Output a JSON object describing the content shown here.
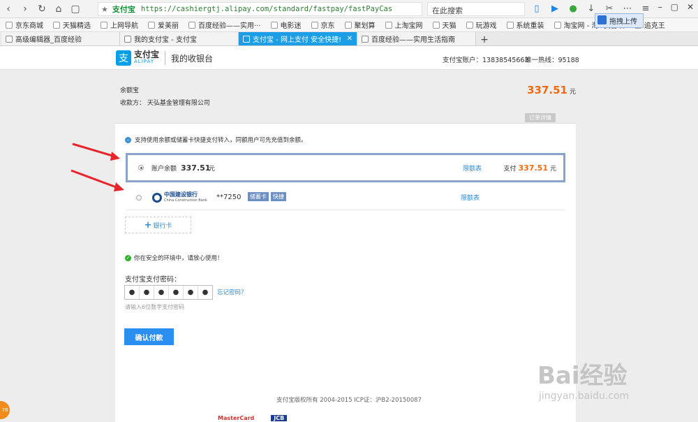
{
  "browser": {
    "url_site": "支付宝",
    "url": "https://cashiergtj.alipay.com/standard/fastpay/fastPayCashier.htm?outBizNo=:",
    "search_placeholder": "在此搜索",
    "upload_tooltip": "拖拽上传",
    "bookmarks": [
      "京东商城",
      "天猫精选",
      "上网导航",
      "爱美丽",
      "百度经验——实用···",
      "电影迷",
      "京东",
      "聚划算",
      "上淘宝网",
      "天猫",
      "玩游戏",
      "系统重装",
      "淘宝网 - 淘! 我喜欢",
      "追克王"
    ],
    "tabs": [
      {
        "label": "高级编辑器_百度经验",
        "active": false
      },
      {
        "label": "我的支付宝 - 支付宝",
        "active": false
      },
      {
        "label": "支付宝 - 网上支付 安全快捷!",
        "active": true
      },
      {
        "label": "百度经验——实用生活指南",
        "active": false
      }
    ]
  },
  "header": {
    "logo_cn": "支付宝",
    "logo_en": "ALIPAY",
    "title": "我的收银台",
    "account": "支付宝账户：13838545663",
    "hotline": "唯一热线：95188"
  },
  "order": {
    "name": "余额宝",
    "payee": "收款方： 天弘基金管理有限公司",
    "amount": "337.51",
    "unit": "元",
    "detail_button": "订单详情"
  },
  "payment": {
    "tip": "支持使用余额或储蓄卡快捷支付转入，同额用户可先充值到余额。",
    "balance_option": {
      "label": "账户余额",
      "amount": "337.51",
      "unit": "元",
      "limit": "限额表",
      "pay_label": "支付",
      "pay_amount": "337.51",
      "pay_unit": "元"
    },
    "bank_option": {
      "bank_cn": "中国建设银行",
      "bank_en": "China Construction Bank",
      "card_no": "**7250",
      "tag_type": "储蓄卡",
      "tag_fast": "快捷",
      "limit": "限额表"
    },
    "add_card": "银行卡",
    "safe_text": "你在安全的环境中，请放心使用！",
    "password_label": "支付宝支付密码：",
    "password_dots": [
      "●",
      "●",
      "●",
      "●",
      "●",
      "●"
    ],
    "forgot": "忘记密码？",
    "password_hint": "请输入6位数字支付密码",
    "confirm": "确认付款"
  },
  "footer": {
    "copyright": "支付宝版权所有 2004-2015 ICP证：沪B2-20150087",
    "card_logos": [
      "MasterCard",
      "JCB"
    ]
  },
  "side_badge": "78",
  "watermark": {
    "main": "Bai经验",
    "sub": "jingyan.baidu.com"
  },
  "colors": {
    "accent": "#f26a10",
    "link": "#2f8cd4",
    "button": "#2a8ff0",
    "alipay_blue": "#00a0e9",
    "active_tab": "#1b9ee5"
  }
}
